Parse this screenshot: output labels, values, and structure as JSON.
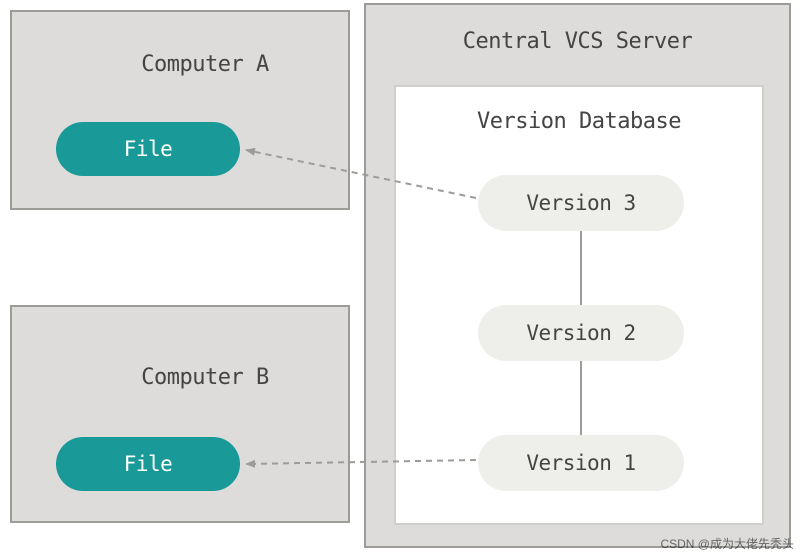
{
  "computer_a": {
    "title": "Computer A",
    "file_label": "File"
  },
  "computer_b": {
    "title": "Computer B",
    "file_label": "File"
  },
  "server": {
    "title": "Central VCS Server",
    "db": {
      "title": "Version Database",
      "versions": {
        "v3": "Version 3",
        "v2": "Version 2",
        "v1": "Version 1"
      }
    }
  },
  "colors": {
    "panel_bg": "#dddcdb",
    "panel_border": "#9c9b98",
    "file_pill": "#1a9999",
    "version_pill": "#eeeeea",
    "db_border": "#cfcfcc"
  },
  "watermark": "CSDN @成为大佬先秃头"
}
